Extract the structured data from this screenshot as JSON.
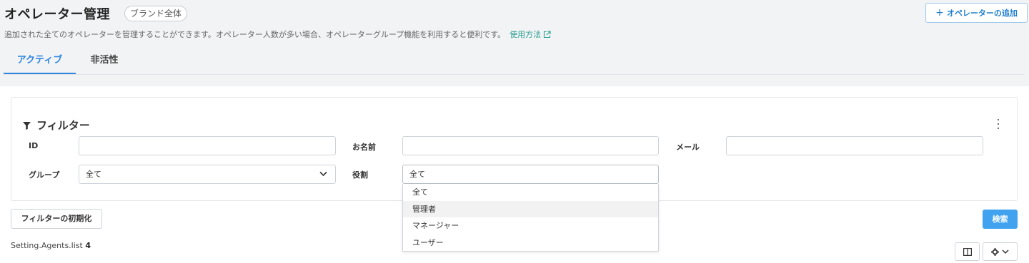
{
  "page": {
    "title": "オペレーター管理",
    "scope_badge": "ブランド全体",
    "description": "追加された全てのオペレーターを管理することができます。オペレーター人数が多い場合、オペレーターグループ機能を利用すると便利です。",
    "help_link": "使用方法",
    "add_button": "オペレーターの追加"
  },
  "tabs": [
    {
      "label": "アクティブ",
      "active": true
    },
    {
      "label": "非活性",
      "active": false
    }
  ],
  "filter": {
    "title": "フィルター",
    "fields": {
      "id": {
        "label": "ID",
        "value": ""
      },
      "name": {
        "label": "お名前",
        "value": ""
      },
      "email": {
        "label": "メール",
        "value": ""
      },
      "group": {
        "label": "グループ",
        "value": "全て"
      },
      "role": {
        "label": "役割",
        "value": "全て"
      }
    },
    "role_options": [
      "全て",
      "管理者",
      "マネージャー",
      "ユーザー"
    ],
    "reset_button": "フィルターの初期化",
    "search_button": "検索"
  },
  "list": {
    "label": "Setting.Agents.list",
    "count": "4"
  },
  "colors": {
    "accent": "#2e86de",
    "search_button": "#41a3ef",
    "link": "#2a9d90"
  }
}
